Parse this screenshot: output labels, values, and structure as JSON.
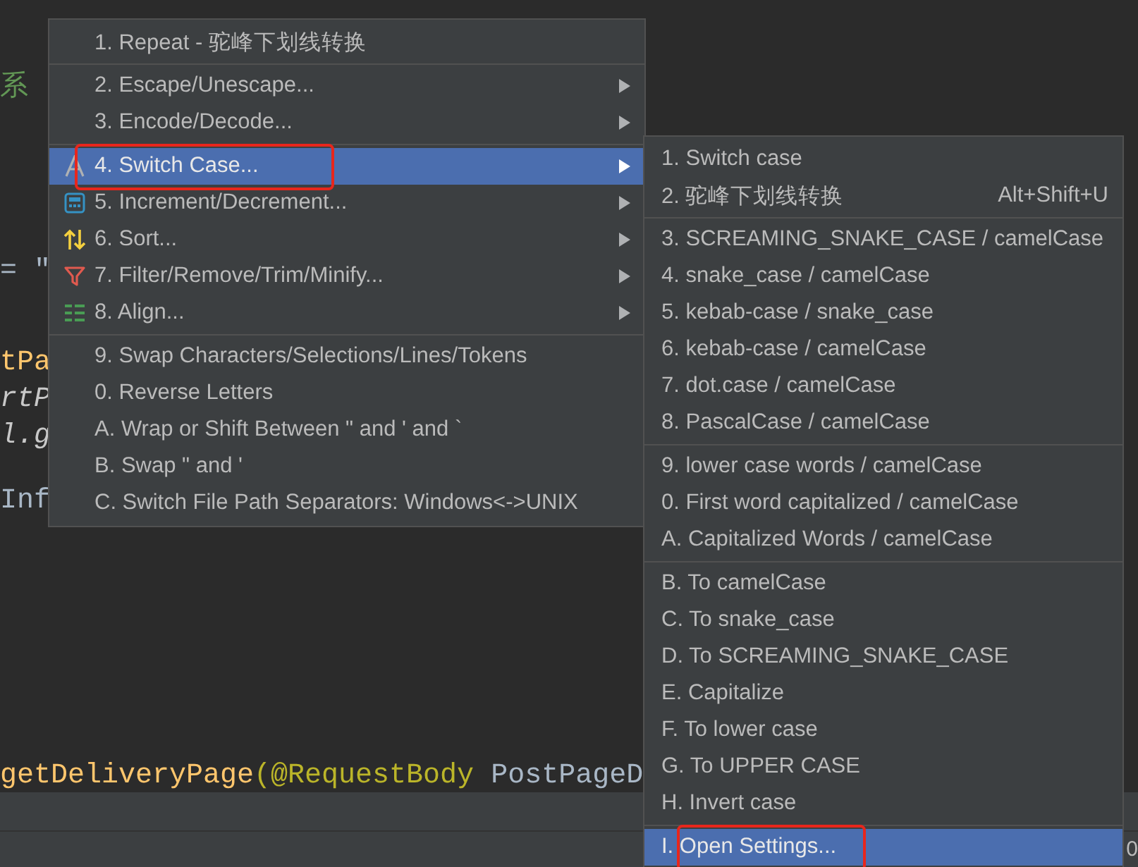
{
  "editor": {
    "code_lines": [
      {
        "segments": [
          {
            "text": "系",
            "kind": "comment"
          }
        ]
      },
      {
        "segments": [
          {
            "text": "= \"",
            "kind": "plain"
          }
        ]
      },
      {
        "segments": [
          {
            "text": "tPa",
            "kind": "method"
          }
        ]
      },
      {
        "segments": [
          {
            "text": "rtP",
            "kind": "italic"
          }
        ]
      },
      {
        "segments": [
          {
            "text": "l.g",
            "kind": "italic"
          }
        ]
      },
      {
        "segments": [
          {
            "text": "Inf",
            "kind": "plain"
          }
        ]
      },
      {
        "segments": [
          {
            "text": "getDeliveryPage",
            "kind": "method"
          },
          {
            "text": "(@RequestBody",
            "kind": "annotation"
          },
          {
            "text": " PostPageD",
            "kind": "plain"
          }
        ]
      }
    ]
  },
  "status_text": "0",
  "menus": [
    {
      "groups": [
        {
          "items": [
            {
              "label": "1. Repeat - 驼峰下划线转换",
              "submenu": false,
              "selected": false,
              "annotated": false
            }
          ]
        },
        {
          "items": [
            {
              "label": "2. Escape/Unescape...",
              "submenu": true,
              "selected": false,
              "annotated": false
            },
            {
              "label": "3. Encode/Decode...",
              "submenu": true,
              "selected": false,
              "annotated": false
            }
          ]
        },
        {
          "items": [
            {
              "label": "4. Switch Case...",
              "submenu": true,
              "selected": true,
              "annotated": true
            },
            {
              "label": "5. Increment/Decrement...",
              "submenu": true,
              "selected": false,
              "annotated": false
            },
            {
              "label": "6. Sort...",
              "submenu": true,
              "selected": false,
              "annotated": false
            },
            {
              "label": "7. Filter/Remove/Trim/Minify...",
              "submenu": true,
              "selected": false,
              "annotated": false
            },
            {
              "label": "8. Align...",
              "submenu": true,
              "selected": false,
              "annotated": false
            }
          ]
        },
        {
          "items": [
            {
              "label": "9. Swap Characters/Selections/Lines/Tokens",
              "submenu": false,
              "selected": false,
              "annotated": false
            },
            {
              "label": "0. Reverse Letters",
              "submenu": false,
              "selected": false,
              "annotated": false
            },
            {
              "label": "A. Wrap or Shift Between \" and ' and `",
              "submenu": false,
              "selected": false,
              "annotated": false
            },
            {
              "label": "B. Swap \" and '",
              "submenu": false,
              "selected": false,
              "annotated": false
            },
            {
              "label": "C. Switch File Path Separators: Windows<->UNIX",
              "submenu": false,
              "selected": false,
              "annotated": false
            }
          ]
        }
      ]
    },
    {
      "groups": [
        {
          "items": [
            {
              "label": "1. Switch case",
              "selected": false,
              "annotated": false
            },
            {
              "label": "2. 驼峰下划线转换",
              "shortcut": "Alt+Shift+U",
              "selected": false,
              "annotated": false
            }
          ]
        },
        {
          "items": [
            {
              "label": "3. SCREAMING_SNAKE_CASE / camelCase",
              "selected": false,
              "annotated": false
            },
            {
              "label": "4. snake_case / camelCase",
              "selected": false,
              "annotated": false
            },
            {
              "label": "5. kebab-case / snake_case",
              "selected": false,
              "annotated": false
            },
            {
              "label": "6. kebab-case / camelCase",
              "selected": false,
              "annotated": false
            },
            {
              "label": "7. dot.case / camelCase",
              "selected": false,
              "annotated": false
            },
            {
              "label": "8. PascalCase / camelCase",
              "selected": false,
              "annotated": false
            }
          ]
        },
        {
          "items": [
            {
              "label": "9. lower case words / camelCase",
              "selected": false,
              "annotated": false
            },
            {
              "label": "0. First word capitalized / camelCase",
              "selected": false,
              "annotated": false
            },
            {
              "label": "A. Capitalized Words / camelCase",
              "selected": false,
              "annotated": false
            }
          ]
        },
        {
          "items": [
            {
              "label": "B. To camelCase",
              "selected": false,
              "annotated": false
            },
            {
              "label": "C. To snake_case",
              "selected": false,
              "annotated": false
            },
            {
              "label": "D. To SCREAMING_SNAKE_CASE",
              "selected": false,
              "annotated": false
            },
            {
              "label": "E. Capitalize",
              "selected": false,
              "annotated": false
            },
            {
              "label": "F. To lower case",
              "selected": false,
              "annotated": false
            },
            {
              "label": "G. To UPPER CASE",
              "selected": false,
              "annotated": false
            },
            {
              "label": "H. Invert case",
              "selected": false,
              "annotated": false
            }
          ]
        },
        {
          "items": [
            {
              "label": "I. Open Settings...",
              "selected": true,
              "annotated": true
            }
          ]
        }
      ]
    }
  ]
}
